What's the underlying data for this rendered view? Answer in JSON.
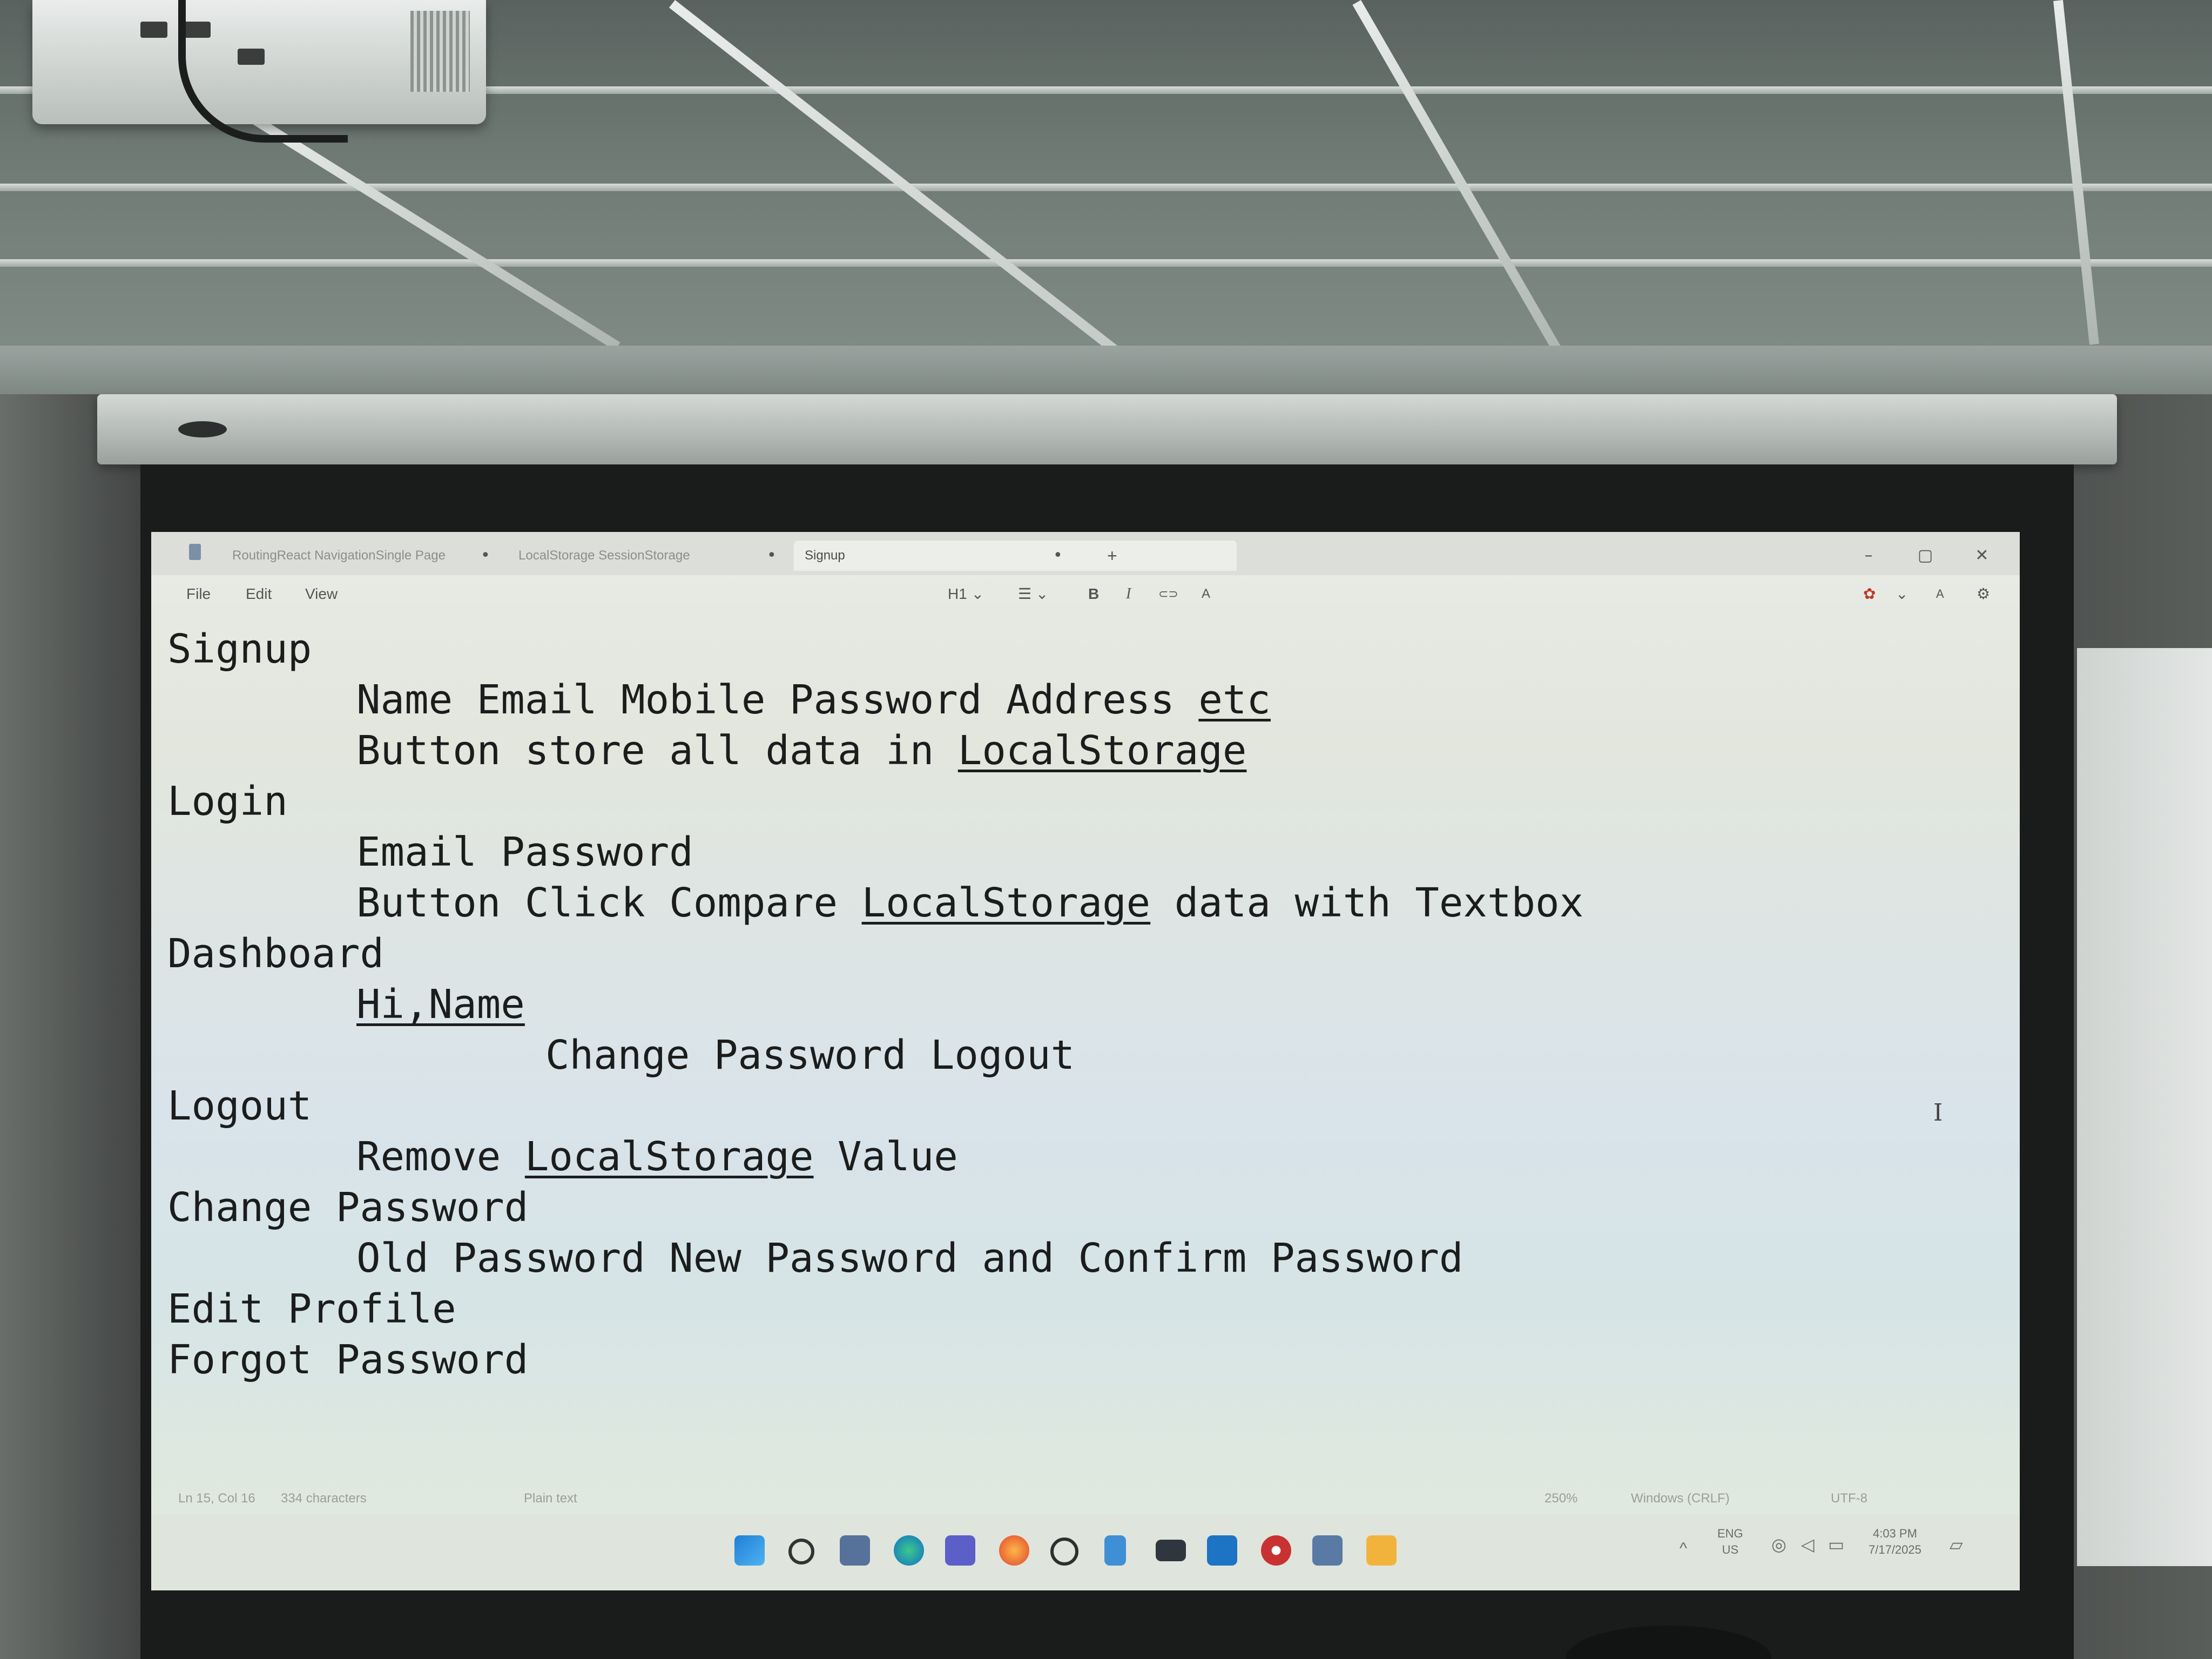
{
  "window": {
    "tabs": [
      {
        "label": "RoutingReact NavigationSingle Page"
      },
      {
        "label": "LocalStorage SessionStorage"
      },
      {
        "label": "Signup"
      }
    ],
    "new_tab_symbol": "+",
    "controls": {
      "minimize": "–",
      "maximize": "▢",
      "close": "✕"
    }
  },
  "menu": {
    "file": "File",
    "edit": "Edit",
    "view": "View"
  },
  "toolbar": {
    "heading": "H1",
    "list": "☰",
    "bold": "B",
    "italic": "I",
    "link": "⊂⊃",
    "clear": "A"
  },
  "editor": {
    "lines": [
      {
        "indent": 0,
        "text": "Signup"
      },
      {
        "indent": 1,
        "text": "Name Email Mobile Password Address ",
        "link": "etc"
      },
      {
        "indent": 1,
        "text": "Button store all data in ",
        "link": "LocalStorage"
      },
      {
        "indent": 0,
        "text": "Login"
      },
      {
        "indent": 1,
        "text": "Email Password"
      },
      {
        "indent": 1,
        "text": "Button Click Compare ",
        "link": "LocalStorage",
        "after": " data with Textbox"
      },
      {
        "indent": 0,
        "text": "Dashboard"
      },
      {
        "indent": 1,
        "text": "",
        "link": "Hi,Name"
      },
      {
        "indent": 2,
        "text": "Change Password Logout"
      },
      {
        "indent": 0,
        "text": "Logout"
      },
      {
        "indent": 1,
        "text": "Remove ",
        "link": "LocalStorage",
        "after": " Value"
      },
      {
        "indent": 0,
        "text": "Change Password"
      },
      {
        "indent": 1,
        "text": "Old Password New Password and Confirm Password"
      },
      {
        "indent": 0,
        "text": "Edit Profile"
      },
      {
        "indent": 0,
        "text": "Forgot Password"
      }
    ]
  },
  "status": {
    "position": "Ln 15, Col 16",
    "characters": "334 characters",
    "format": "Plain text",
    "zoom": "250%",
    "line_ending": "Windows (CRLF)",
    "encoding": "UTF-8"
  },
  "taskbar": {
    "language_top": "ENG",
    "language_bottom": "US",
    "time": "4:03 PM",
    "date": "7/17/2025"
  }
}
